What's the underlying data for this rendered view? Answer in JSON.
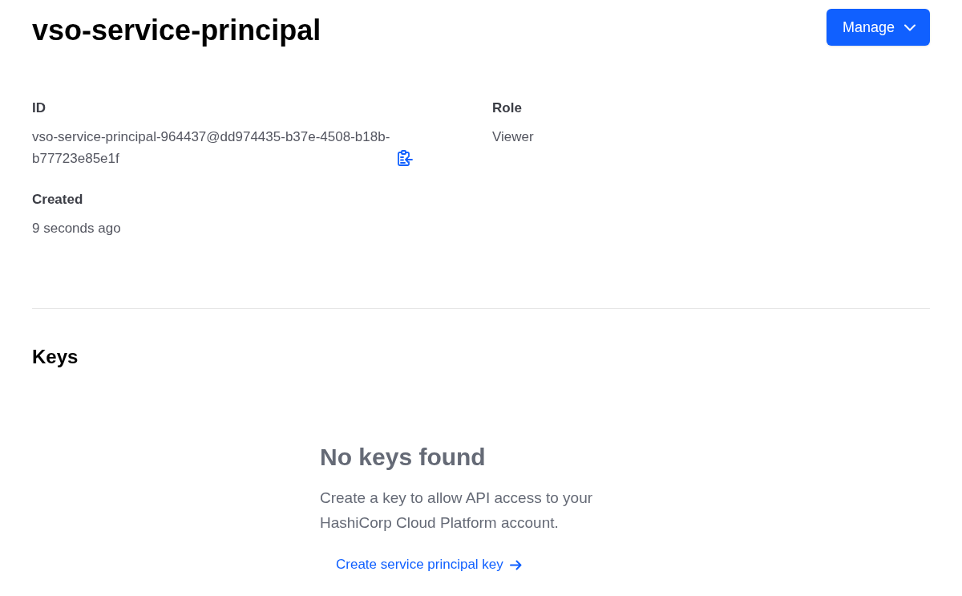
{
  "header": {
    "title": "vso-service-principal",
    "manage_button": {
      "label": "Manage"
    }
  },
  "details": [
    {
      "label": "ID",
      "value": "vso-service-principal-964437@dd974435-b37e-4508-b18b-b77723e85e1f",
      "copyable": true
    },
    {
      "label": "Role",
      "value": "Viewer",
      "copyable": false
    },
    {
      "label": "Created",
      "value": "9 seconds ago",
      "copyable": false
    }
  ],
  "keys_section": {
    "title": "Keys",
    "empty_state": {
      "title": "No keys found",
      "message": "Create a key to allow API access to your HashiCorp Cloud Platform account.",
      "link": "Create service principal key"
    }
  }
}
